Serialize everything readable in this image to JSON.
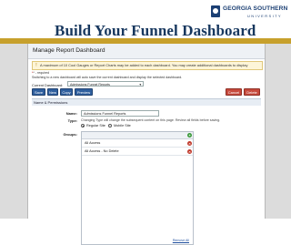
{
  "slide": {
    "title": "Build Your Funnel Dashboard",
    "logo_name": "GEORGIA SOUTHERN",
    "logo_sub": "UNIVERSITY",
    "colors": {
      "title": "#17375e",
      "rule": "#c7a02c",
      "logo": "#1b3f73"
    }
  },
  "app": {
    "title": "Manage Report Dashboard",
    "warning": "A maximum of 10 Cool Gauges or Report Charts may be added to each dashboard. You may create additional dashboards to display",
    "required_note": "* - required",
    "switch_note": "Switching to a new dashboard will auto save the current dashboard and display the selected dashboard.",
    "current_dashboard_label": "Current Dashboard:",
    "current_dashboard_value": "Admissions Funnel Reports",
    "toolbar": {
      "save": "Save",
      "new": "New",
      "copy": "Copy",
      "preview": "Preview",
      "cancel": "Cancel",
      "delete": "Delete"
    },
    "section_title": "Name & Permissions",
    "name_label": "Name:",
    "name_value": "Admissions Funnel Reports",
    "type_label": "Type:",
    "type_note": "Changing Type will change the subsequent content on this page. Review all fields before saving.",
    "type_options": [
      {
        "label": "Regular Site",
        "selected": true
      },
      {
        "label": "Mobile Site",
        "selected": false
      }
    ],
    "groups_label": "Groups:",
    "groups": [
      {
        "label": "All Access"
      },
      {
        "label": "All Access - No Delete"
      }
    ],
    "remove_all": "Remove All"
  }
}
